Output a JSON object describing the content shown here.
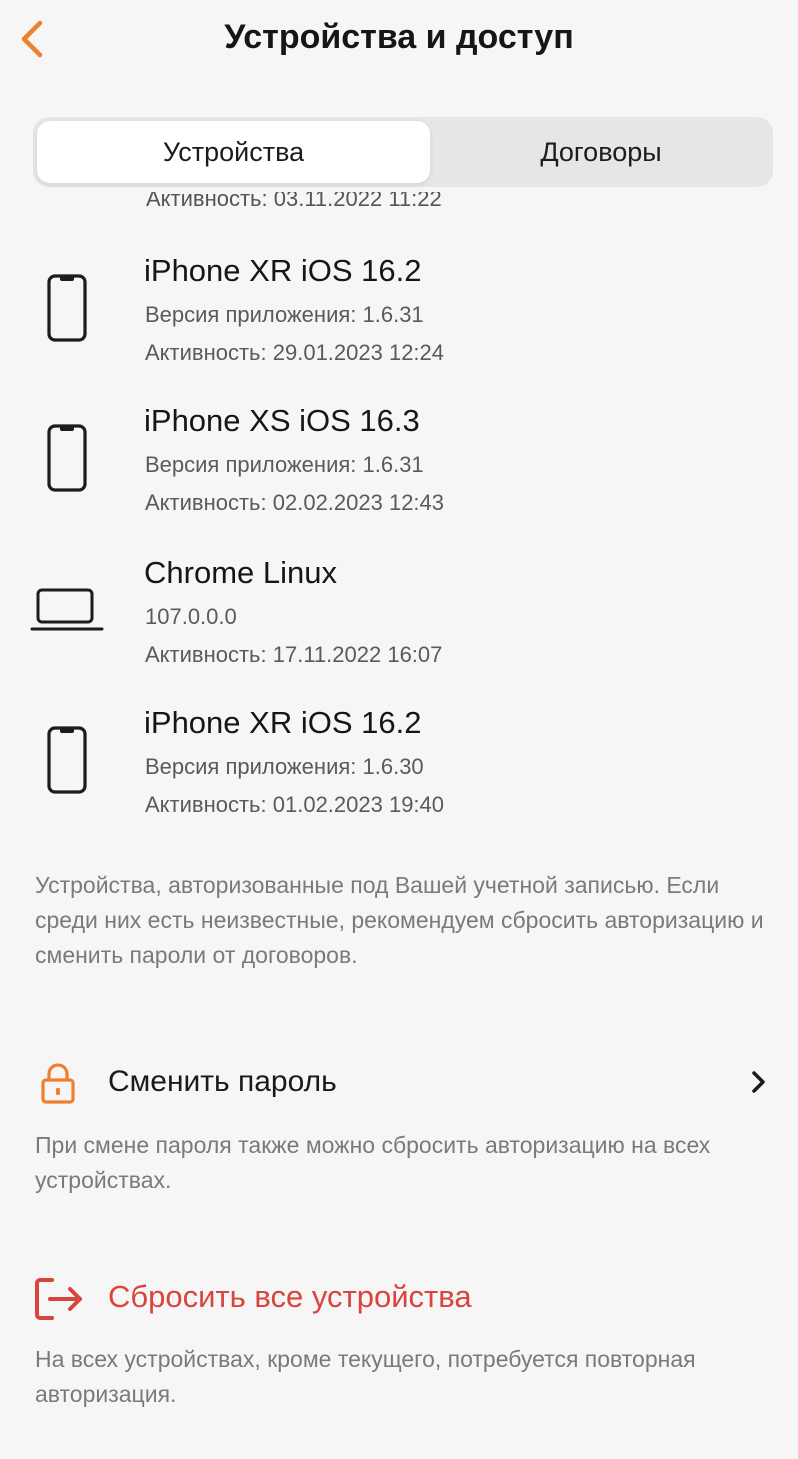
{
  "header": {
    "title": "Устройства и доступ",
    "back_icon": "chevron-left-icon",
    "accent_color": "#f07f2c"
  },
  "tabs": [
    {
      "label": "Устройства",
      "active": true
    },
    {
      "label": "Договоры",
      "active": false
    }
  ],
  "devices_cut_activity": "Активность: 03.11.2022 11:22",
  "devices": [
    {
      "icon": "smartphone-icon",
      "name": "iPhone XR iOS 16.2",
      "line1": "Версия приложения: 1.6.31",
      "line2": "Активность: 29.01.2023 12:24"
    },
    {
      "icon": "smartphone-icon",
      "name": "iPhone XS iOS 16.3",
      "line1": "Версия приложения: 1.6.31",
      "line2": "Активность: 02.02.2023 12:43"
    },
    {
      "icon": "laptop-icon",
      "name": "Chrome Linux",
      "line1": "107.0.0.0",
      "line2": "Активность: 17.11.2022 16:07"
    },
    {
      "icon": "smartphone-icon",
      "name": "iPhone XR iOS 16.2",
      "line1": "Версия приложения: 1.6.30",
      "line2": "Активность: 01.02.2023 19:40"
    }
  ],
  "info_text": "Устройства, авторизованные под Вашей учетной записью. Если среди них есть неизвестные, рекомендуем сбросить авторизацию и сменить пароли от договоров.",
  "change_password": {
    "icon": "lock-icon",
    "label": "Сменить пароль",
    "hint": "При смене пароля также можно сбросить авторизацию на всех устройствах."
  },
  "reset_devices": {
    "icon": "logout-icon",
    "label": "Сбросить все устройства",
    "hint": "На всех устройствах, кроме текущего, потребуется повторная авторизация.",
    "color": "#d8453d"
  }
}
